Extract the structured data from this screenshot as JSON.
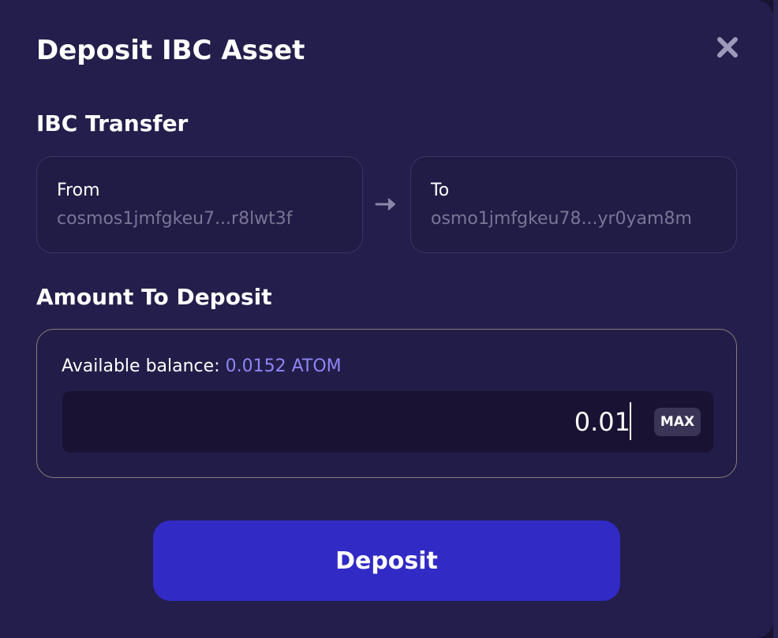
{
  "modal": {
    "title": "Deposit IBC Asset",
    "close_icon": "close-icon"
  },
  "transfer": {
    "heading": "IBC Transfer",
    "from_label": "From",
    "from_address": "cosmos1jmfgkeu7...r8lwt3f",
    "arrow_icon": "arrow-right-icon",
    "to_label": "To",
    "to_address": "osmo1jmfgkeu78...yr0yam8m"
  },
  "amount": {
    "heading": "Amount To Deposit",
    "balance_label": "Available balance:",
    "balance_value": "0.0152 ATOM",
    "input_value": "0.01",
    "max_label": "MAX"
  },
  "actions": {
    "deposit_label": "Deposit"
  },
  "colors": {
    "modal_bg": "#231e4b",
    "accent_button": "#322ac5",
    "balance_accent": "#8f85f5",
    "muted_text": "#7a7595"
  }
}
